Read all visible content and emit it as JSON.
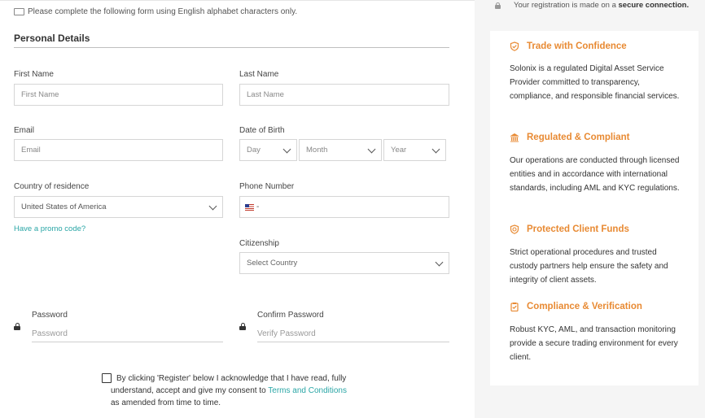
{
  "notice": {
    "text": "Please complete the following form using English alphabet characters only.",
    "icon": "keyboard-icon"
  },
  "section": {
    "title": "Personal Details"
  },
  "form": {
    "first_name": {
      "label": "First Name",
      "placeholder": "First Name"
    },
    "last_name": {
      "label": "Last Name",
      "placeholder": "Last Name"
    },
    "email": {
      "label": "Email",
      "placeholder": "Email"
    },
    "dob": {
      "label": "Date of Birth",
      "day": "Day",
      "month": "Month",
      "year": "Year"
    },
    "country": {
      "label": "Country of residence",
      "value": "United States of America"
    },
    "phone": {
      "label": "Phone Number",
      "country_code": "-"
    },
    "promo": {
      "text": "Have a promo code?"
    },
    "citizenship": {
      "label": "Citizenship",
      "value": "Select Country"
    },
    "password": {
      "label": "Password",
      "placeholder": "Password"
    },
    "confirm_password": {
      "label": "Confirm Password",
      "placeholder": "Verify Password"
    },
    "consent": {
      "line1": "By clicking 'Register' below I acknowledge that I have read, fully",
      "line2_prefix": "understand, accept and give my consent to ",
      "link": "Terms and Conditions",
      "line3": "as amended from time to time."
    }
  },
  "sidebar": {
    "secure_prefix": "Your registration is made on a ",
    "secure_bold": "secure connection.",
    "features": [
      {
        "icon": "shield-check-icon",
        "title": "Trade with Confidence",
        "text": "Solonix is a regulated Digital Asset Service Provider committed to transparency, compliance, and responsible financial services."
      },
      {
        "icon": "bank-icon",
        "title": "Regulated & Compliant",
        "text": "Our operations are conducted through licensed entities and in accordance with international standards, including AML and KYC regulations."
      },
      {
        "icon": "shield-coin-icon",
        "title": "Protected Client Funds",
        "text": "Strict operational procedures and trusted custody partners help ensure the safety and integrity of client assets."
      },
      {
        "icon": "clipboard-check-icon",
        "title": "Compliance & Verification",
        "text": "Robust KYC, AML, and transaction monitoring provide a secure trading environment for every client."
      }
    ]
  },
  "colors": {
    "accent": "#e88a33",
    "link": "#2aa6a6",
    "panel_bg": "#f5f5f5"
  }
}
